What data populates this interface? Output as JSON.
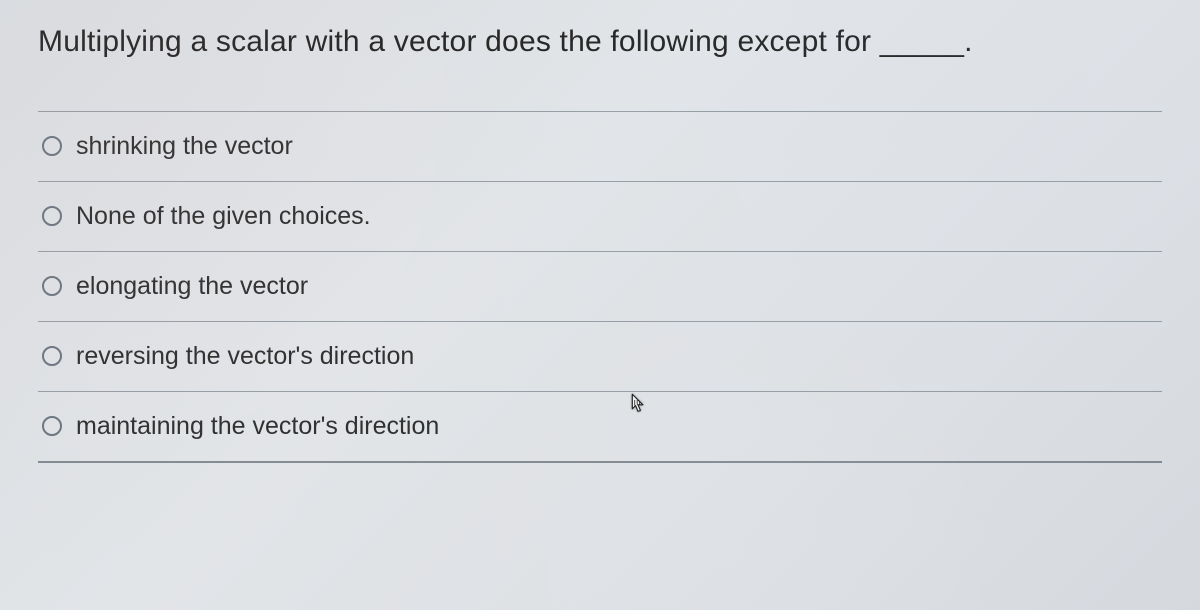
{
  "question": {
    "text": "Multiplying a scalar with a vector does the following except for _____."
  },
  "options": [
    {
      "label": "shrinking the vector"
    },
    {
      "label": "None of the given choices."
    },
    {
      "label": "elongating the vector"
    },
    {
      "label": "reversing the vector's direction"
    },
    {
      "label": "maintaining the vector's direction"
    }
  ]
}
